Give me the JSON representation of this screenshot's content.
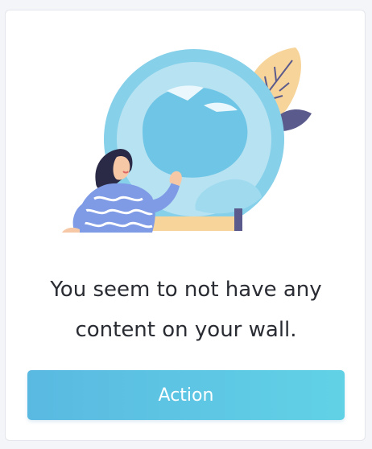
{
  "empty_state": {
    "illustration_icon": "crystal-ball-woman-illustration",
    "message": "You seem to not have any content on your wall.",
    "action_label": "Action"
  },
  "colors": {
    "button_gradient_start": "#5ab9e1",
    "button_gradient_end": "#61d2e6",
    "ball_blue": "#7fcfea",
    "accent_yellow": "#f7d49a",
    "accent_navy": "#5a5a8c",
    "text": "#2a2c33"
  }
}
